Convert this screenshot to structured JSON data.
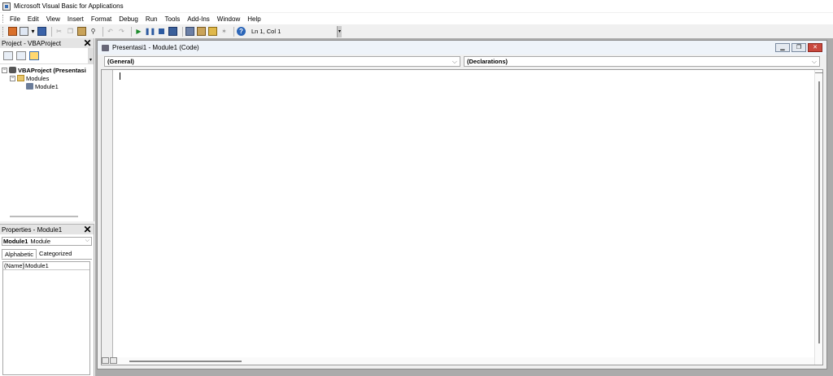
{
  "app": {
    "title": "Microsoft Visual Basic for Applications"
  },
  "menu": [
    "File",
    "Edit",
    "View",
    "Insert",
    "Format",
    "Debug",
    "Run",
    "Tools",
    "Add-Ins",
    "Window",
    "Help"
  ],
  "toolbar": {
    "position": "Ln 1, Col 1"
  },
  "project": {
    "title": "Project - VBAProject",
    "tree": {
      "root": "VBAProject (Presentasi",
      "folder": "Modules",
      "module": "Module1"
    }
  },
  "properties": {
    "title": "Properties - Module1",
    "object_name": "Module1",
    "object_type": "Module",
    "tabs": [
      "Alphabetic",
      "Categorized"
    ],
    "rows": [
      {
        "key": "(Name)",
        "value": "Module1"
      }
    ]
  },
  "code_window": {
    "title": "Presentasi1 - Module1 (Code)",
    "object_dropdown": "(General)",
    "procedure_dropdown": "(Declarations)"
  }
}
